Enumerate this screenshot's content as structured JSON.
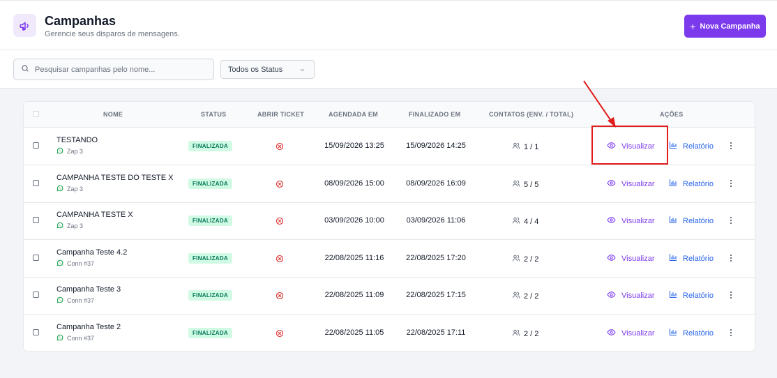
{
  "header": {
    "title": "Campanhas",
    "subtitle": "Gerencie seus disparos de mensagens.",
    "new_button_label": "Nova Campanha",
    "icon": "megaphone-icon"
  },
  "filters": {
    "search_placeholder": "Pesquisar campanhas pelo nome...",
    "status_selected": "Todos os Status"
  },
  "table": {
    "columns": [
      "NOME",
      "STATUS",
      "ABRIR TICKET",
      "AGENDADA EM",
      "FINALIZADO EM",
      "CONTATOS (ENV. / TOTAL)",
      "AÇÕES"
    ],
    "rows": [
      {
        "name": "TESTANDO",
        "connection": "Zap 3",
        "status": "FINALIZADA",
        "scheduled": "15/09/2026 13:25",
        "finished": "15/09/2026 14:25",
        "contacts": "1 / 1",
        "view_label": "Visualizar",
        "report_label": "Relatório"
      },
      {
        "name": "CAMPANHA TESTE DO TESTE X",
        "connection": "Zap 3",
        "status": "FINALIZADA",
        "scheduled": "08/09/2026 15:00",
        "finished": "08/09/2026 16:09",
        "contacts": "5 / 5",
        "view_label": "Visualizar",
        "report_label": "Relatório"
      },
      {
        "name": "CAMPANHA TESTE X",
        "connection": "Zap 3",
        "status": "FINALIZADA",
        "scheduled": "03/09/2026 10:00",
        "finished": "03/09/2026 11:06",
        "contacts": "4 / 4",
        "view_label": "Visualizar",
        "report_label": "Relatório"
      },
      {
        "name": "Campanha Teste 4.2",
        "connection": "Conn #37",
        "status": "FINALIZADA",
        "scheduled": "22/08/2025 11:16",
        "finished": "22/08/2025 17:20",
        "contacts": "2 / 2",
        "view_label": "Visualizar",
        "report_label": "Relatório"
      },
      {
        "name": "Campanha Teste 3",
        "connection": "Conn #37",
        "status": "FINALIZADA",
        "scheduled": "22/08/2025 11:09",
        "finished": "22/08/2025 17:15",
        "contacts": "2 / 2",
        "view_label": "Visualizar",
        "report_label": "Relatório"
      },
      {
        "name": "Campanha Teste 2",
        "connection": "Conn #37",
        "status": "FINALIZADA",
        "scheduled": "22/08/2025 11:05",
        "finished": "22/08/2025 17:11",
        "contacts": "2 / 2",
        "view_label": "Visualizar",
        "report_label": "Relatório"
      }
    ]
  },
  "colors": {
    "accent": "#7c3aed",
    "link_blue": "#2563eb",
    "status_green_bg": "#d1fae5",
    "status_green_text": "#047857",
    "ticket_red": "#dc2626",
    "annotation_red": "#e11d1d",
    "whatsapp_green": "#16a34a"
  }
}
